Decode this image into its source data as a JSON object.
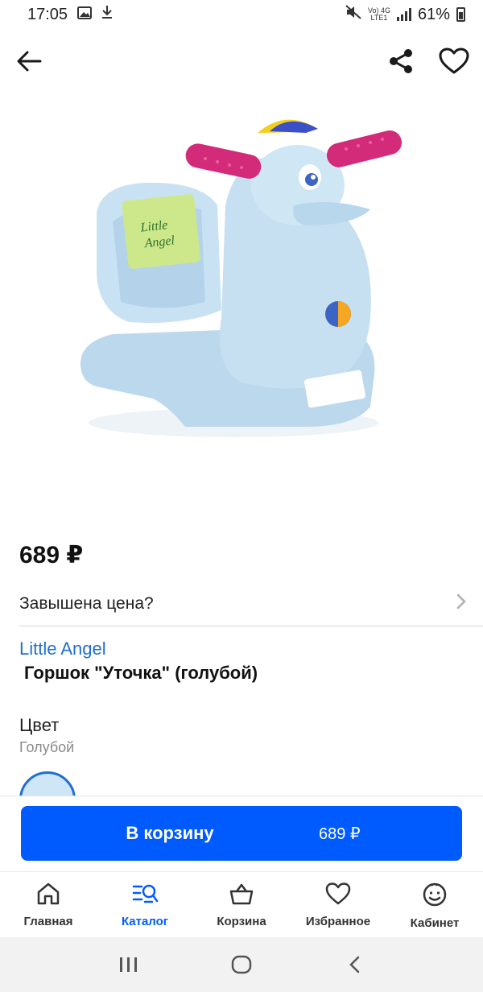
{
  "status_bar": {
    "time": "17:05",
    "net_top": "Vo) 4G",
    "net_bottom": "LTE1",
    "battery": "61%"
  },
  "product": {
    "price": "689 ₽",
    "overpriced_question": "Завышена цена?",
    "brand": "Little Angel",
    "name": "Горшок \"Уточка\" (голубой)",
    "color_title": "Цвет",
    "color_value": "Голубой",
    "swatch_color": "#cfe6f7"
  },
  "cart": {
    "button_label": "В корзину",
    "button_price": "689 ₽",
    "accent": "#005bff"
  },
  "bottom_nav": {
    "items": [
      {
        "label": "Главная",
        "icon": "home-icon"
      },
      {
        "label": "Каталог",
        "icon": "catalog-search-icon"
      },
      {
        "label": "Корзина",
        "icon": "basket-icon"
      },
      {
        "label": "Избранное",
        "icon": "heart-icon"
      },
      {
        "label": "Кабинет",
        "icon": "profile-icon"
      }
    ]
  }
}
